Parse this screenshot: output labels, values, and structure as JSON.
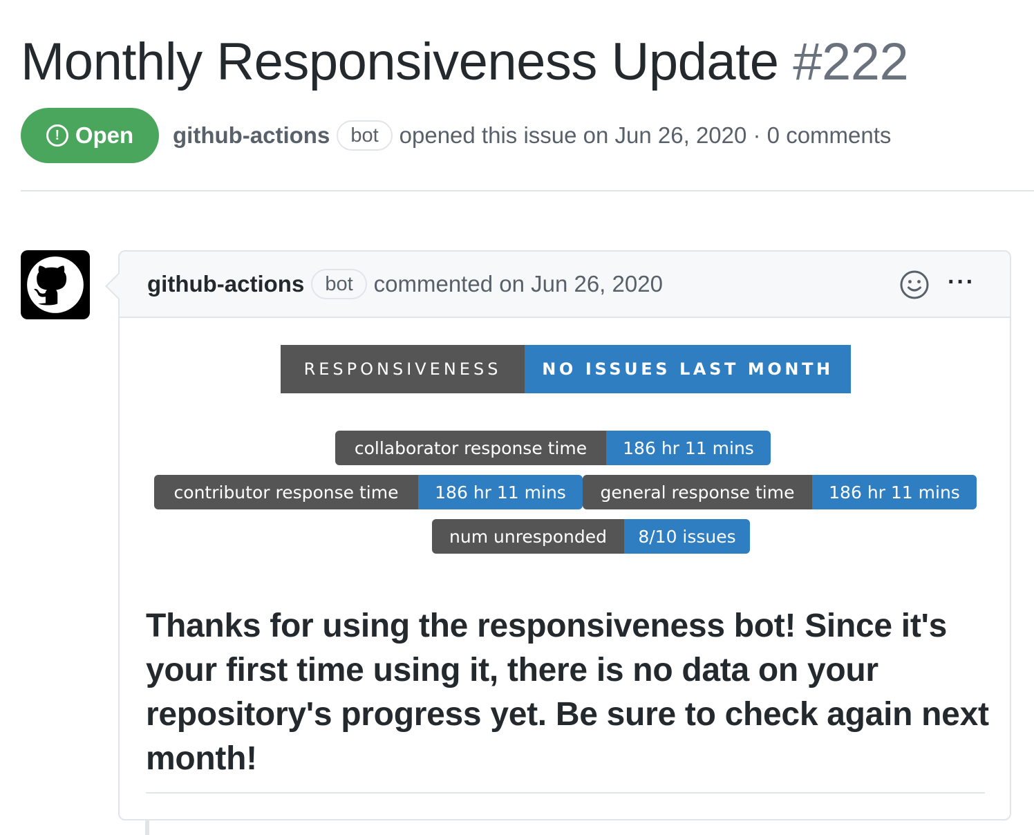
{
  "issue": {
    "title": "Monthly Responsiveness Update",
    "number": "#222",
    "state": "Open",
    "author": "github-actions",
    "author_label": "bot",
    "meta_text": "opened this issue on Jun 26, 2020 · 0 comments"
  },
  "comment": {
    "author": "github-actions",
    "author_label": "bot",
    "meta_text": "commented on Jun 26, 2020",
    "more_label": "···",
    "hero_badge": {
      "label": "RESPONSIVENESS",
      "value": "NO ISSUES LAST MONTH"
    },
    "badges": [
      {
        "label": "collaborator response time",
        "value": "186 hr 11 mins"
      },
      {
        "label": "contributor response time",
        "value": "186 hr 11 mins"
      },
      {
        "label": "general response time",
        "value": "186 hr 11 mins"
      },
      {
        "label": "num unresponded",
        "value": "8/10 issues"
      }
    ],
    "body": "Thanks for using the responsiveness bot! Since it's your first time using it, there is no data on your repository's progress yet. Be sure to check again next month!"
  },
  "colors": {
    "open_green": "#4aa65c",
    "badge_label": "#555555",
    "badge_value": "#2f7ec1",
    "border": "#e1e4e8"
  },
  "icons": {
    "state": "issue-opened-icon",
    "avatar": "github-logo-icon",
    "reaction": "smiley-icon",
    "more": "kebab-horizontal-icon"
  }
}
